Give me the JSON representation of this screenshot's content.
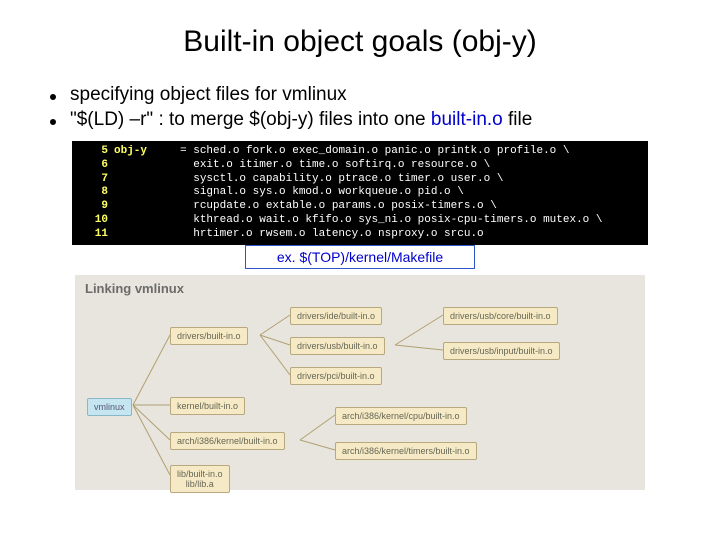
{
  "title": "Built-in object goals (obj-y)",
  "bullets": {
    "b1": "specifying object files for vmlinux",
    "b2_pre": "\"$(LD) –r\" : to merge $(obj-y) files into one ",
    "b2_hl": "built-in.o",
    "b2_post": " file"
  },
  "code": {
    "lines": [
      {
        "n": "5",
        "hl": "obj-y",
        "rest": "     = sched.o fork.o exec_domain.o panic.o printk.o profile.o \\"
      },
      {
        "n": "6",
        "hl": "",
        "rest": "            exit.o itimer.o time.o softirq.o resource.o \\"
      },
      {
        "n": "7",
        "hl": "",
        "rest": "            sysctl.o capability.o ptrace.o timer.o user.o \\"
      },
      {
        "n": "8",
        "hl": "",
        "rest": "            signal.o sys.o kmod.o workqueue.o pid.o \\"
      },
      {
        "n": "9",
        "hl": "",
        "rest": "            rcupdate.o extable.o params.o posix-timers.o \\"
      },
      {
        "n": "10",
        "hl": "",
        "rest": "            kthread.o wait.o kfifo.o sys_ni.o posix-cpu-timers.o mutex.o \\"
      },
      {
        "n": "11",
        "hl": "",
        "rest": "            hrtimer.o rwsem.o latency.o nsproxy.o srcu.o"
      }
    ]
  },
  "caption": "ex. $(TOP)/kernel/Makefile",
  "diagram": {
    "title": "Linking vmlinux",
    "vmlinux": "vmlinux",
    "drivers_builtin": "drivers/built-in.o",
    "kernel_builtin": "kernel/built-in.o",
    "arch_kernel_builtin": "arch/i386/kernel/built-in.o",
    "lib_builtin": "lib/built-in.o\nlib/lib.a",
    "ide": "drivers/ide/built-in.o",
    "usb": "drivers/usb/built-in.o",
    "pci": "drivers/pci/built-in.o",
    "usb_core": "drivers/usb/core/built-in.o",
    "usb_input": "drivers/usb/input/built-in.o",
    "arch_cpu": "arch/i386/kernel/cpu/built-in.o",
    "arch_timers": "arch/i386/kernel/timers/built-in.o"
  }
}
